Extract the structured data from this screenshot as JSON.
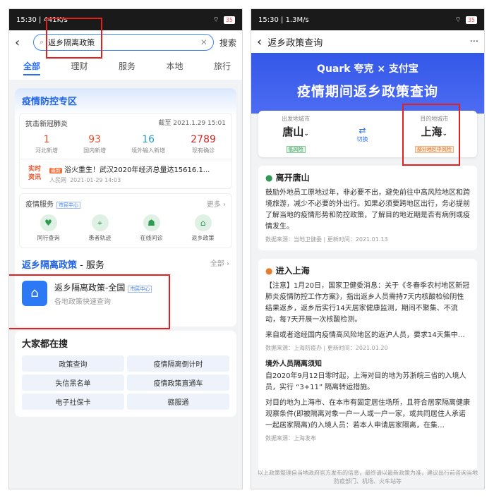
{
  "left": {
    "status": {
      "time": "15:30",
      "speed": "441K/s",
      "battery": "35"
    },
    "search": {
      "query": "返乡隔离政策",
      "button": "搜索"
    },
    "tabs": [
      "全部",
      "理财",
      "服务",
      "本地",
      "旅行"
    ],
    "epidemic": {
      "title": "疫情防控专区",
      "subtitle": "抗击新冠肺炎",
      "deadline": "截至 2021.1.29 15:01",
      "stats": [
        {
          "n": "1",
          "label": "河北新增",
          "color": "#e5532b"
        },
        {
          "n": "93",
          "label": "国内新增",
          "color": "#e5532b"
        },
        {
          "n": "16",
          "label": "境外输入新增",
          "color": "#2a9dbf"
        },
        {
          "n": "2789",
          "label": "现有确诊",
          "color": "#d32828"
        }
      ],
      "news": {
        "icon": "实时资讯",
        "tag": "最新",
        "title": "浴火重生！武汉2020年经济总量达15616.1...",
        "source": "人民网",
        "time": "2021-01-29 14:03"
      },
      "services": {
        "title": "疫情服务",
        "badge": "市民中心",
        "more": "更多 ›",
        "items": [
          "同行查询",
          "患者轨迹",
          "在线问诊",
          "返乡政策"
        ]
      }
    },
    "policy": {
      "title_blue": "返乡隔离政策",
      "title_rest": " - 服务",
      "all": "全部 ›",
      "item_title": "返乡隔离政策-全国",
      "item_badge": "市民中心",
      "item_sub": "各地政策快速查询"
    },
    "hot": {
      "title": "大家都在搜",
      "items": [
        "政策查询",
        "疫情隔离倒计时",
        "失信黑名单",
        "疫情政策直通车",
        "电子社保卡",
        "赣服通"
      ]
    }
  },
  "right": {
    "status": {
      "time": "15:30",
      "speed": "1.3M/s",
      "battery": "35"
    },
    "header": {
      "title": "返乡政策查询",
      "more": "···"
    },
    "banner": {
      "logos": "Quark 夸克  ×  支付宝",
      "title": "疫情期间返乡政策查询"
    },
    "from": {
      "label": "出发地城市",
      "city": "唐山",
      "risk": "低风险"
    },
    "switch": "切换",
    "to": {
      "label": "目的地城市",
      "city": "上海",
      "risk": "部分地区中风险"
    },
    "leave": {
      "title": "离开唐山",
      "body": "鼓励外地员工原地过年，非必要不出，避免前往中高风险地区和跨境旅游，减少不必要的外出行。如果必须要跨地区出行，务必提前了解当地的疫情形势和防控政策，了解目的地近期是否有病例或疫情发生。",
      "source": "数据来源：当地卫健委 | 更新时间：2021.01.13"
    },
    "enter": {
      "title": "进入上海",
      "body1": "【注意】1月20日，国家卫健委消息：关于《冬春季农村地区新冠肺炎疫情防控工作方案》，指出返乡人员需持7天内核酸检验阴性结果返乡，返乡后实行14天居家健康监测，期间不聚集、不流动，每7天开展一次核酸检测。",
      "body2": "来自或者途经国内疫情高风险地区的返沪人员，要求14天集中…",
      "source1": "数据来源：上海防疫办 | 更新时间：2021.01.20",
      "sub": "境外人员隔离须知",
      "body3": "自2020年9月12日零时起，上海对目的地为苏浙皖三省的入境人员，实行 “3+11” 隔离转运措施。",
      "body4": "对目的地为上海市、在本市有固定居住场所，且符合居家隔离健康观察条件(即被隔离对象一户一人或一户一家，或共同居住人承诺一起居家隔离)的入境人员：若本人申请居家隔离，在集…",
      "source2": "数据来源：上海发布"
    },
    "footer": "以上政策整理自当地政府官方发布的信息，最终请以最新政策为准，建议出行前咨询当地防疫部门、机场、火车站等"
  }
}
